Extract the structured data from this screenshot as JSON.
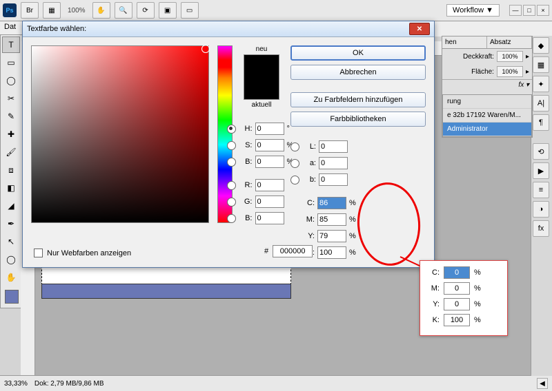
{
  "top": {
    "zoom": "100%",
    "workflow": "Workflow ▼"
  },
  "menu": {
    "file": "Dat"
  },
  "status": {
    "zoom": "33,33%",
    "docinfo": "Dok: 2,79 MB/9,86 MB"
  },
  "panels": {
    "tab_hen": "hen",
    "tab_absatz": "Absatz",
    "opacity_label": "Deckkraft:",
    "opacity": "100%",
    "fill_label": "Fläche:",
    "fill": "100%",
    "fx": "fx ▾",
    "layer_group": "rung",
    "layer_text": "e 32b 17192 Waren/M...",
    "layer_admin": "Administrator"
  },
  "dialog": {
    "title": "Textfarbe wählen:",
    "ok": "OK",
    "cancel": "Abbrechen",
    "add_swatch": "Zu Farbfeldern hinzufügen",
    "libraries": "Farbbibliotheken",
    "neu": "neu",
    "aktuell": "aktuell",
    "H": "0",
    "S": "0",
    "B": "0",
    "R": "0",
    "G": "0",
    "B2": "0",
    "L": "0",
    "a": "0",
    "b": "0",
    "C": "86",
    "M": "85",
    "Y": "79",
    "K": "100",
    "hex": "000000",
    "webonly": "Nur Webfarben anzeigen"
  },
  "callout": {
    "C": "0",
    "M": "0",
    "Y": "0",
    "K": "100"
  },
  "labels": {
    "H": "H:",
    "S": "S:",
    "B": "B:",
    "R": "R:",
    "G": "G:",
    "Bb": "B:",
    "L": "L:",
    "a": "a:",
    "bb": "b:",
    "C": "C:",
    "M": "M:",
    "Y": "Y:",
    "K": "K:",
    "pct": "%",
    "deg": "°",
    "hash": "#"
  }
}
